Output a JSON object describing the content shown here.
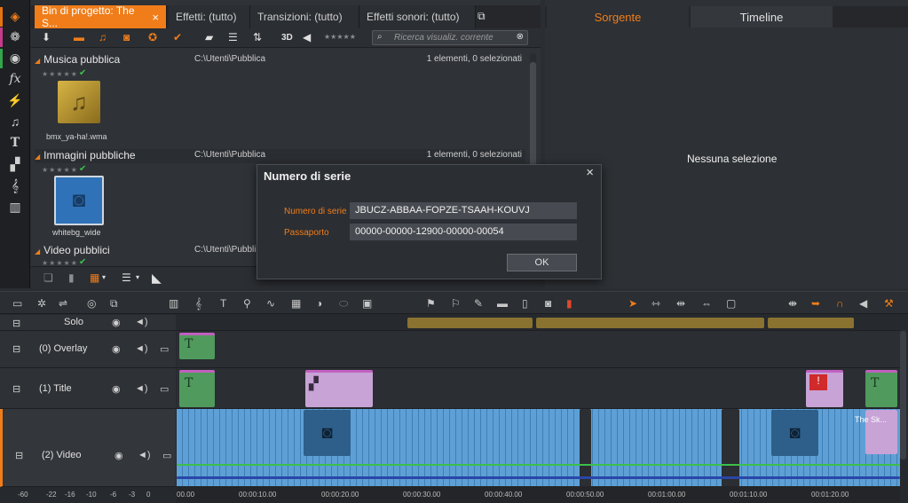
{
  "library": {
    "tabs": [
      {
        "label": "Bin di progetto: The S...",
        "close": "×"
      },
      {
        "label": "Effetti: (tutto)"
      },
      {
        "label": "Transizioni: (tutto)"
      },
      {
        "label": "Effetti sonori: (tutto)"
      }
    ],
    "toolbar": {
      "view_3d": "3D",
      "search_placeholder": "Ricerca visualiz. corrente"
    },
    "sections": [
      {
        "title": "Musica pubblica",
        "path": "C:\\Utenti\\Pubblica",
        "count": "1 elementi, 0 selezionati",
        "item_label": "bmx_ya-ha!.wma"
      },
      {
        "title": "Immagini pubbliche",
        "path": "C:\\Utenti\\Pubblica",
        "count": "1 elementi, 0 selezionati",
        "item_label": "whitebg_wide"
      },
      {
        "title": "Video pubblici",
        "path": "C:\\Utenti\\Pubblica"
      }
    ],
    "stars": "★★★★★"
  },
  "player": {
    "tab_source": "Sorgente",
    "tab_timeline": "Timeline",
    "empty_text": "Nessuna selezione"
  },
  "dialog": {
    "title": "Numero di serie",
    "close": "×",
    "serial_label": "Numero di serie",
    "serial_value": "JBUCZ-ABBAA-FOPZE-TSAAH-KOUVJ",
    "passport_label": "Passaporto",
    "passport_value": "00000-00000-12900-00000-00054",
    "ok_label": "OK"
  },
  "timeline": {
    "tracks": [
      {
        "name": "Solo"
      },
      {
        "name": "(0) Overlay"
      },
      {
        "name": "(1) Title"
      },
      {
        "name": "(2) Video"
      }
    ],
    "ruler": [
      "00.00",
      "00:00:10.00",
      "00:00:20.00",
      "00:00:30.00",
      "00:00:40.00",
      "00:00:50.00",
      "00:01:00.00",
      "00:01:10.00",
      "00:01:20.00"
    ],
    "meter": [
      "-60",
      "-22",
      "-16",
      "-10",
      "-6",
      "-3",
      "0"
    ],
    "clip_text": "The Sk..."
  },
  "colors": {
    "accent": "#f07d1a",
    "title_clip": "#4f9a5c",
    "video_clip": "#5ea0d6",
    "purple_clip": "#c7a3d6",
    "solo_bar": "#8a7230"
  }
}
